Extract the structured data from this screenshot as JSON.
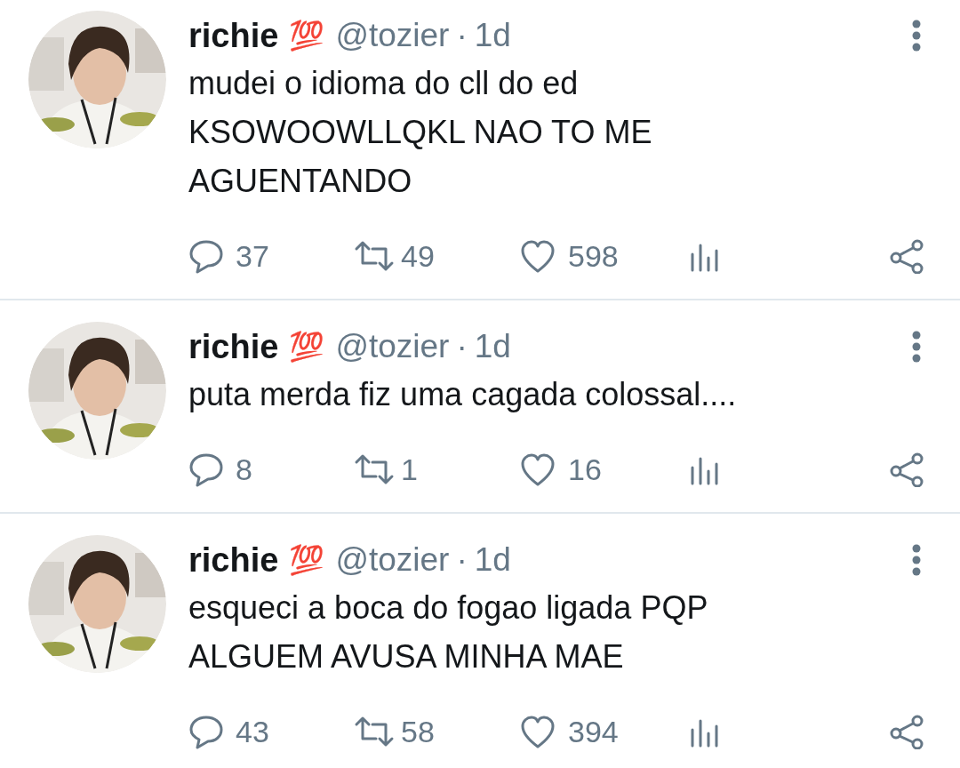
{
  "tweets": [
    {
      "name": "richie",
      "badge": "💯",
      "handle": "@tozier",
      "separator": "·",
      "time": "1d",
      "text": [
        "mudei o idioma do cll do ed",
        "KSOWOOWLLQKL NAO TO ME",
        "AGUENTANDO"
      ],
      "replies": "37",
      "retweets": "49",
      "likes": "598"
    },
    {
      "name": "richie",
      "badge": "💯",
      "handle": "@tozier",
      "separator": "·",
      "time": "1d",
      "text": [
        "puta merda fiz uma cagada colossal...."
      ],
      "replies": "8",
      "retweets": "1",
      "likes": "16"
    },
    {
      "name": "richie",
      "badge": "💯",
      "handle": "@tozier",
      "separator": "·",
      "time": "1d",
      "text": [
        "esqueci a boca do fogao ligada PQP",
        "ALGUEM AVUSA MINHA MAE"
      ],
      "replies": "43",
      "retweets": "58",
      "likes": "394"
    }
  ]
}
